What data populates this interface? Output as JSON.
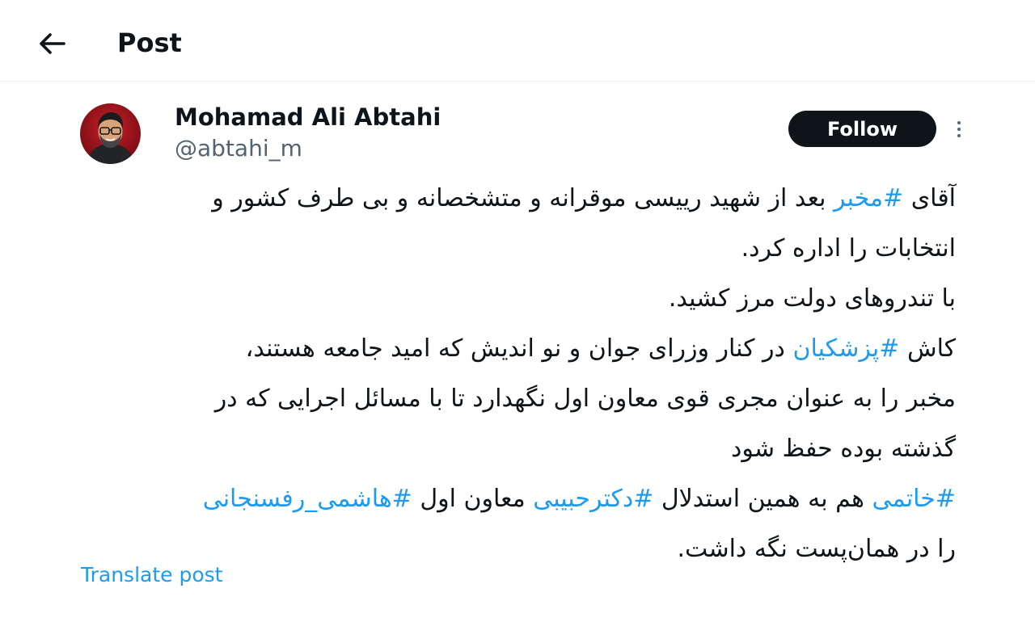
{
  "header": {
    "title": "Post",
    "back_icon": "arrow-left-icon"
  },
  "author": {
    "name": "Mohamad Ali Abtahi",
    "handle": "@abtahi_m",
    "avatar_icon": "avatar-photo"
  },
  "actions": {
    "follow_label": "Follow",
    "more_icon": "more-vertical-icon"
  },
  "tweet": {
    "line1": {
      "pre": "آقای ",
      "tag": "#مخبر",
      "post": " بعد از شهید رییسی موقرانه و متشخصانه و بی طرف کشور و"
    },
    "line2": "انتخابات را اداره کرد.",
    "line3": "با تندروهای دولت مرز کشید.",
    "line4": {
      "pre": "کاش ",
      "tag": "#پزشکیان",
      "post": " در کنار وزرای جوان و نو اندیش که امید جامعه هستند،"
    },
    "line5": "مخبر را به عنوان مجری قوی معاون اول نگهدارد تا با مسائل اجرایی که در",
    "line6": "گذشته بوده حفظ شود",
    "line7": {
      "tag1": "#خاتمی",
      "mid1": " هم به همین استدلال ",
      "tag2": "#دکترحبیبی",
      "mid2": " معاون اول ",
      "tag3": "#هاشمی_رفسنجانی"
    },
    "line8": "را در همان‌پست نگه داشت."
  },
  "translate_label": "Translate post",
  "colors": {
    "link": "#1d9bf0",
    "text": "#0f1419",
    "muted": "#536471",
    "follow_bg": "#0f1419"
  }
}
